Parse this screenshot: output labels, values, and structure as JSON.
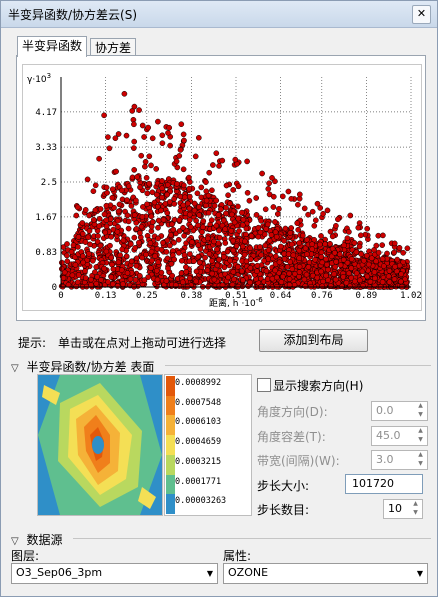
{
  "window": {
    "title": "半变异函数/协方差云(S)"
  },
  "tabs": [
    {
      "label": "半变异函数"
    },
    {
      "label": "协方差"
    }
  ],
  "chart_data": {
    "type": "scatter",
    "title": "",
    "ylabel_prefix": "γ",
    "ylabel_exp": "·10",
    "ylabel_sup": "3",
    "xlabel": "距离, h",
    "xlabel_exp": "·10",
    "xlabel_sup": "-6",
    "x_ticks": [
      "0",
      "0.13",
      "0.25",
      "0.38",
      "0.51",
      "0.64",
      "0.76",
      "0.89",
      "1.02"
    ],
    "y_ticks": [
      "0",
      "0.83",
      "1.67",
      "2.5",
      "3.33",
      "4.17"
    ],
    "xlim": [
      0,
      1.02
    ],
    "ylim": [
      0,
      5.0
    ],
    "grid": true,
    "point_color": "#cc0000",
    "point_count_estimate": 2500,
    "envelope": {
      "x": [
        0.0,
        0.05,
        0.1,
        0.15,
        0.2,
        0.25,
        0.3,
        0.35,
        0.4,
        0.45,
        0.5,
        0.55,
        0.6,
        0.65,
        0.7,
        0.75,
        0.8,
        0.85,
        0.9,
        0.95,
        1.0
      ],
      "typical_max": [
        0.7,
        1.4,
        2.0,
        2.4,
        2.6,
        2.7,
        2.6,
        2.5,
        2.3,
        2.1,
        1.9,
        1.8,
        1.6,
        1.4,
        1.3,
        1.1,
        1.0,
        0.9,
        0.8,
        0.7,
        0.6
      ],
      "outlier_max": [
        0.9,
        2.2,
        3.4,
        4.9,
        4.5,
        4.3,
        4.0,
        3.9,
        3.7,
        3.4,
        3.2,
        3.0,
        2.8,
        2.4,
        2.2,
        2.0,
        1.8,
        1.7,
        1.4,
        1.2,
        1.0
      ]
    }
  },
  "hint": {
    "label": "提示:",
    "text": "单击或在点对上拖动可进行选择"
  },
  "add_layout_button": "添加到布局",
  "surface_section": {
    "title": "半变异函数/协方差 表面"
  },
  "legend": {
    "items": [
      {
        "label": "0.0008992",
        "color": "#e3580a"
      },
      {
        "label": "0.0007548",
        "color": "#f07f1b"
      },
      {
        "label": "0.0006103",
        "color": "#f5b238"
      },
      {
        "label": "0.0004659",
        "color": "#f4df55"
      },
      {
        "label": "0.0003215",
        "color": "#b9d85f"
      },
      {
        "label": "0.0001771",
        "color": "#5fbf8f"
      },
      {
        "label": "0.00003263",
        "color": "#2f8fc8"
      }
    ]
  },
  "search_direction": {
    "label": "显示搜索方向(H)",
    "checked": false
  },
  "fields": {
    "angle_direction": {
      "label": "角度方向(D):",
      "value": "0.0"
    },
    "angle_tolerance": {
      "label": "角度容差(T):",
      "value": "45.0"
    },
    "bandwidth": {
      "label": "带宽(间隔)(W):",
      "value": "3.0"
    },
    "lag_size": {
      "label": "步长大小:",
      "value": "101720"
    },
    "lag_count": {
      "label": "步长数目:",
      "value": "10"
    }
  },
  "datasource_section": {
    "title": "数据源"
  },
  "layer": {
    "label": "图层:",
    "value": "O3_Sep06_3pm"
  },
  "attribute": {
    "label": "属性:",
    "value": "OZONE"
  }
}
